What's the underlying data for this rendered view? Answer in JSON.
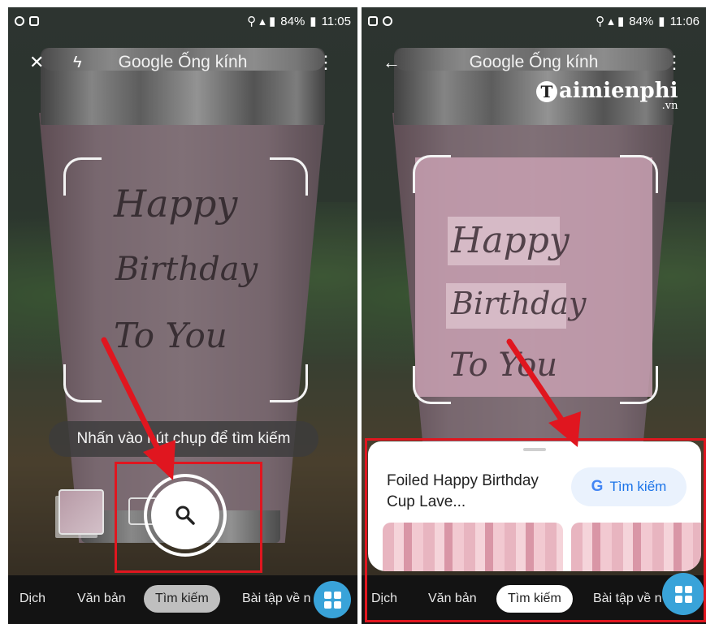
{
  "left": {
    "status": {
      "battery": "84%",
      "time": "11:05"
    },
    "appbar": {
      "title": "Google Ống kính"
    },
    "card_text": {
      "line1": "Happy",
      "line2": "Birthday",
      "line3": "To You"
    },
    "hint": "Nhấn vào nút chụp để tìm kiếm",
    "modes": [
      "Dịch",
      "Văn bản",
      "Tìm kiếm",
      "Bài tập về n"
    ]
  },
  "right": {
    "status": {
      "battery": "84%",
      "time": "11:06"
    },
    "appbar": {
      "title": "Google Ống kính"
    },
    "logo": {
      "mark": "T",
      "text": "aimienphi",
      "suffix": ".vn"
    },
    "card_text": {
      "line1": "Happy",
      "line2": "Birthday",
      "line3": "To You"
    },
    "result": {
      "title": "Foiled Happy Birthday Cup Lave...",
      "search_button": "Tìm kiếm",
      "google_letter": "G"
    },
    "modes": [
      "Dịch",
      "Văn bản",
      "Tìm kiếm",
      "Bài tập về n"
    ]
  },
  "colors": {
    "highlight_box": "#e0161f",
    "fab": "#39a3d9",
    "search_blue": "#1a73e8"
  }
}
